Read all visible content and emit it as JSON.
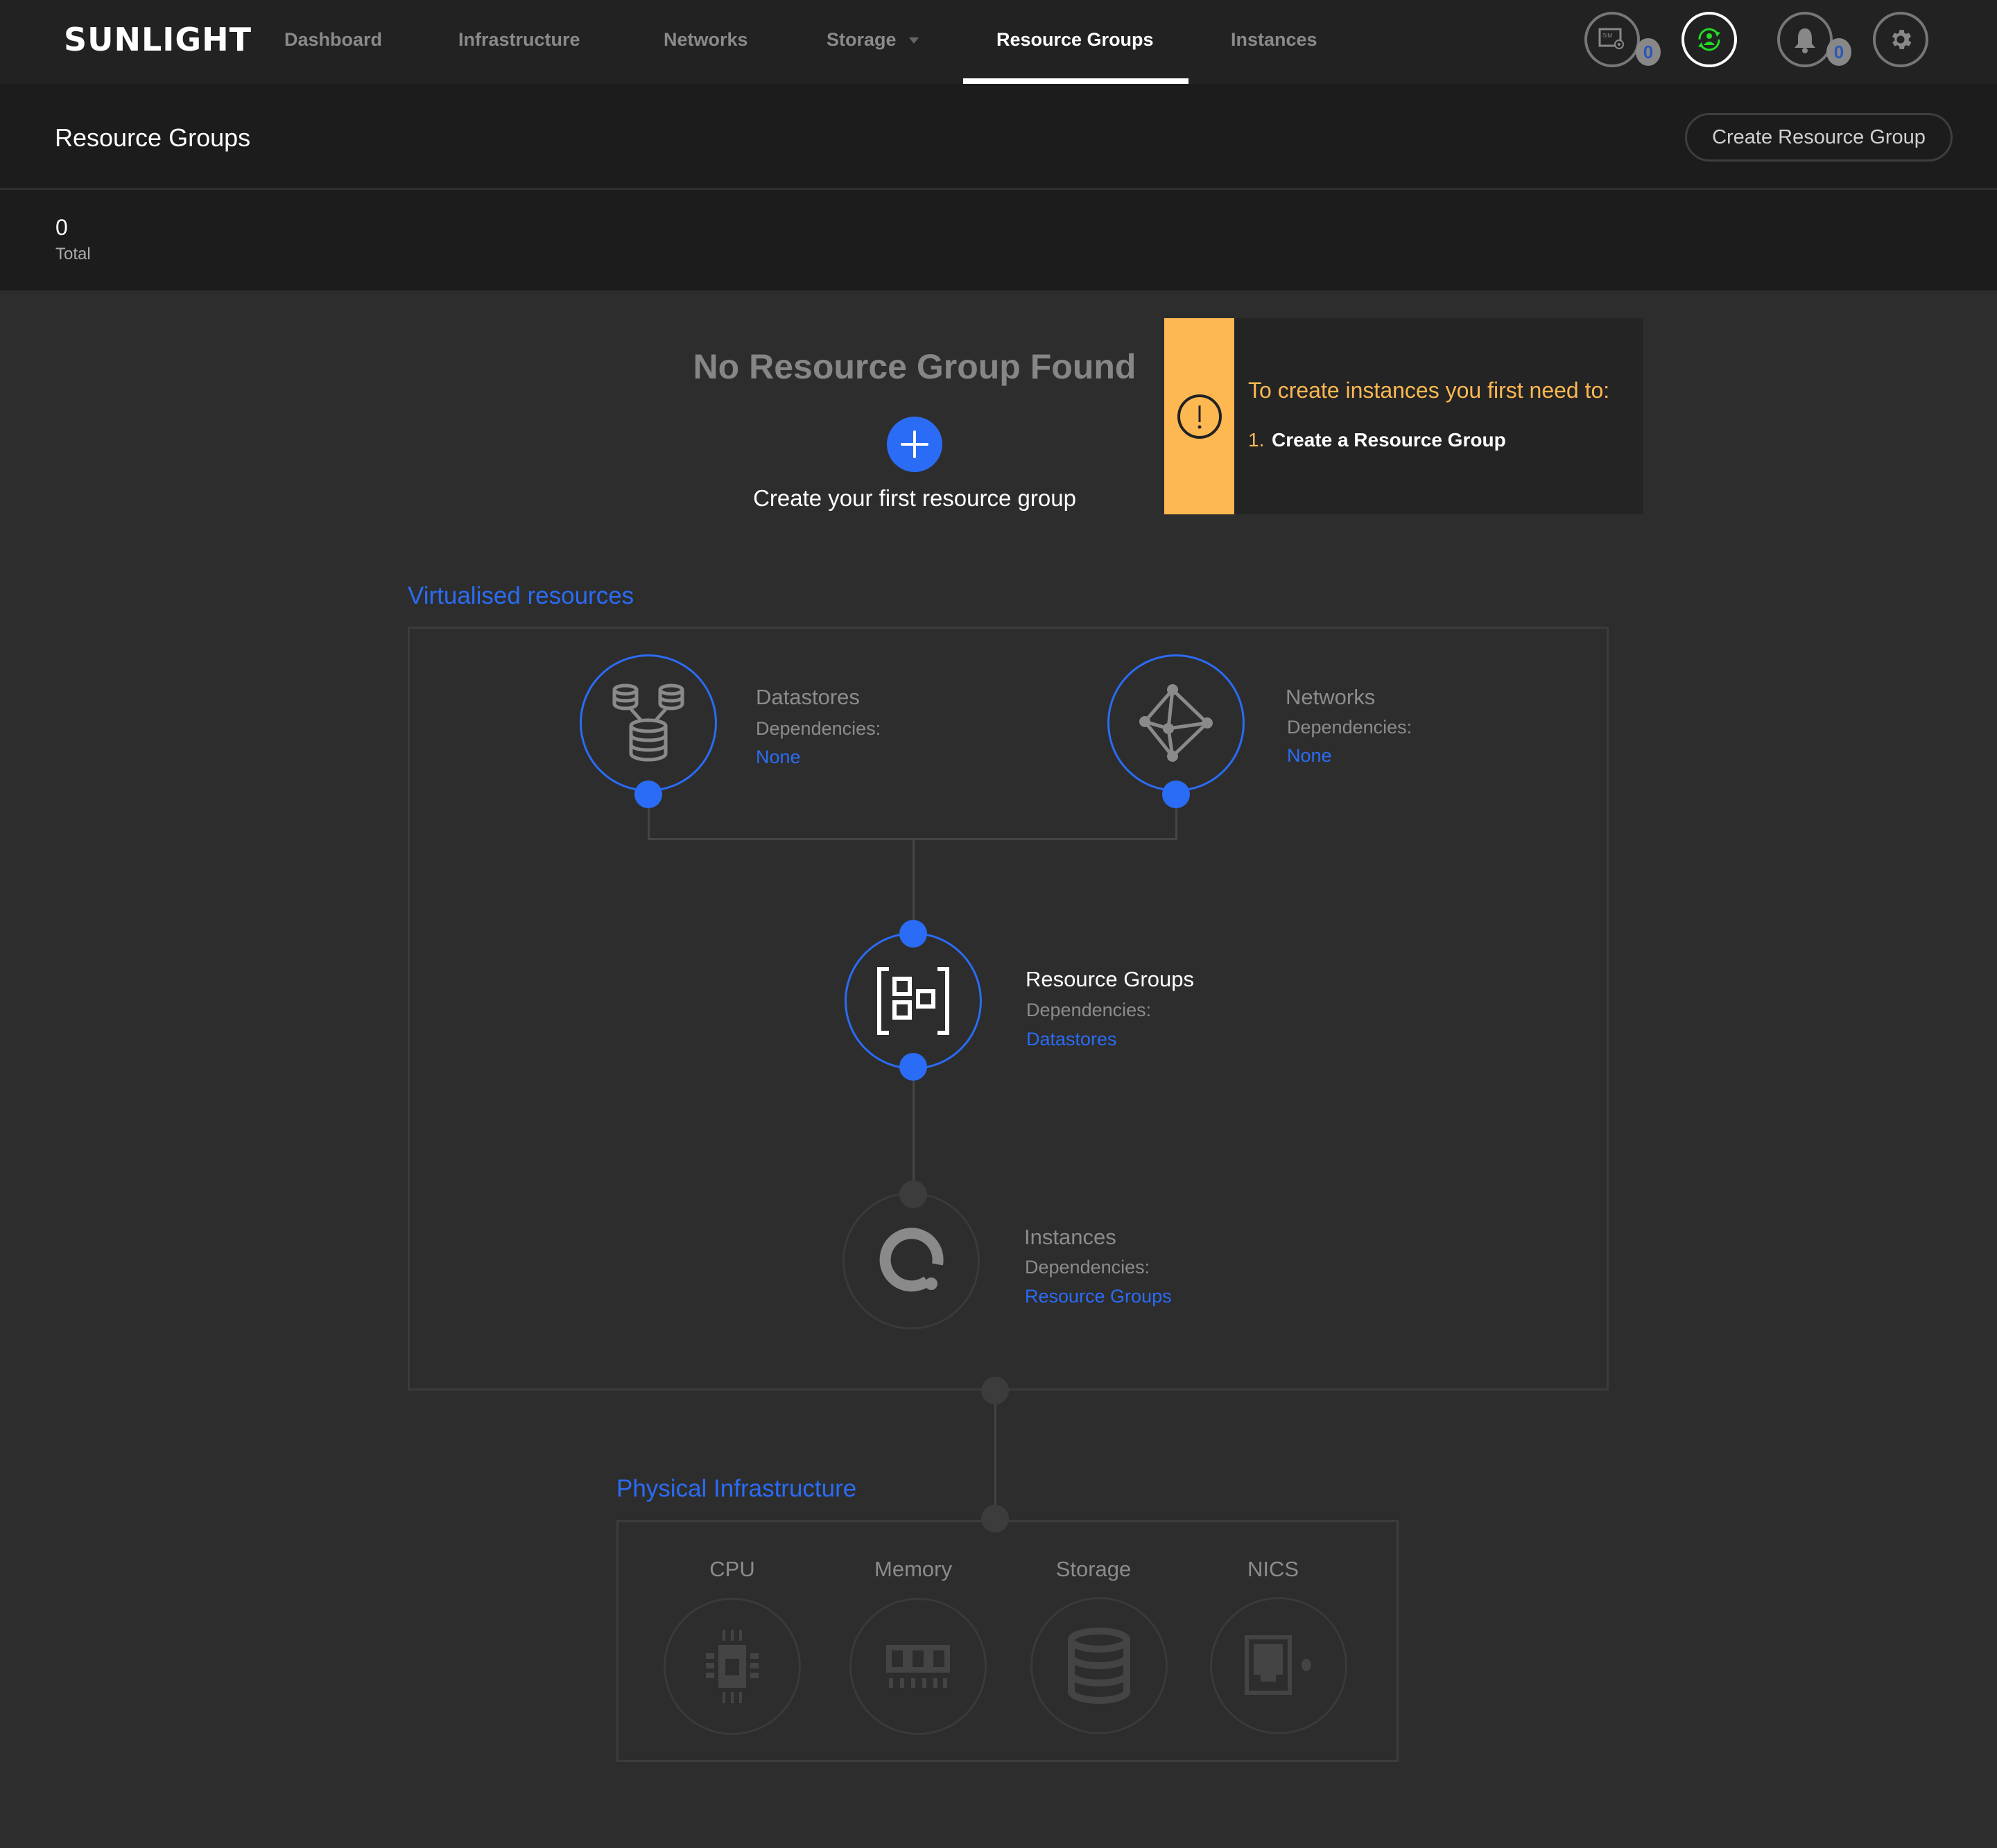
{
  "nav": {
    "logo": "SUNLIGHT",
    "items": [
      {
        "label": "Dashboard",
        "active": false
      },
      {
        "label": "Infrastructure",
        "active": false
      },
      {
        "label": "Networks",
        "active": false
      },
      {
        "label": "Storage",
        "active": false,
        "has_dropdown": true
      },
      {
        "label": "Resource Groups",
        "active": true
      },
      {
        "label": "Instances",
        "active": false
      }
    ],
    "icons": [
      {
        "name": "sim-settings-icon",
        "badge": "0"
      },
      {
        "name": "user-sync-icon",
        "status_color": "#22dd22"
      },
      {
        "name": "bell-icon",
        "badge": "0"
      },
      {
        "name": "gear-icon"
      }
    ]
  },
  "header": {
    "title": "Resource Groups",
    "create_button": "Create Resource Group"
  },
  "stats": {
    "total_value": "0",
    "total_label": "Total"
  },
  "empty_state": {
    "title": "No Resource Group Found",
    "action_label": "Create your first resource group"
  },
  "warning": {
    "title": "To create instances you first need to:",
    "steps": [
      {
        "number": "1.",
        "label": "Create a Resource Group"
      }
    ],
    "accent_color": "#fdb852"
  },
  "virtualised": {
    "label": "Virtualised resources",
    "dependencies_label": "Dependencies:",
    "nodes": [
      {
        "title": "Datastores",
        "dependency": "None",
        "active": true
      },
      {
        "title": "Networks",
        "dependency": "None",
        "active": true
      },
      {
        "title": "Resource Groups",
        "dependency": "Datastores",
        "active": true,
        "current": true
      },
      {
        "title": "Instances",
        "dependency": "Resource Groups",
        "active": false
      }
    ]
  },
  "physical": {
    "label": "Physical Infrastructure",
    "items": [
      {
        "label": "CPU"
      },
      {
        "label": "Memory"
      },
      {
        "label": "Storage"
      },
      {
        "label": "NICS"
      }
    ]
  },
  "colors": {
    "accent_blue": "#2a6cf5",
    "warning_yellow": "#fdb852",
    "background": "#2d2d2d",
    "nav_background": "#222222"
  }
}
